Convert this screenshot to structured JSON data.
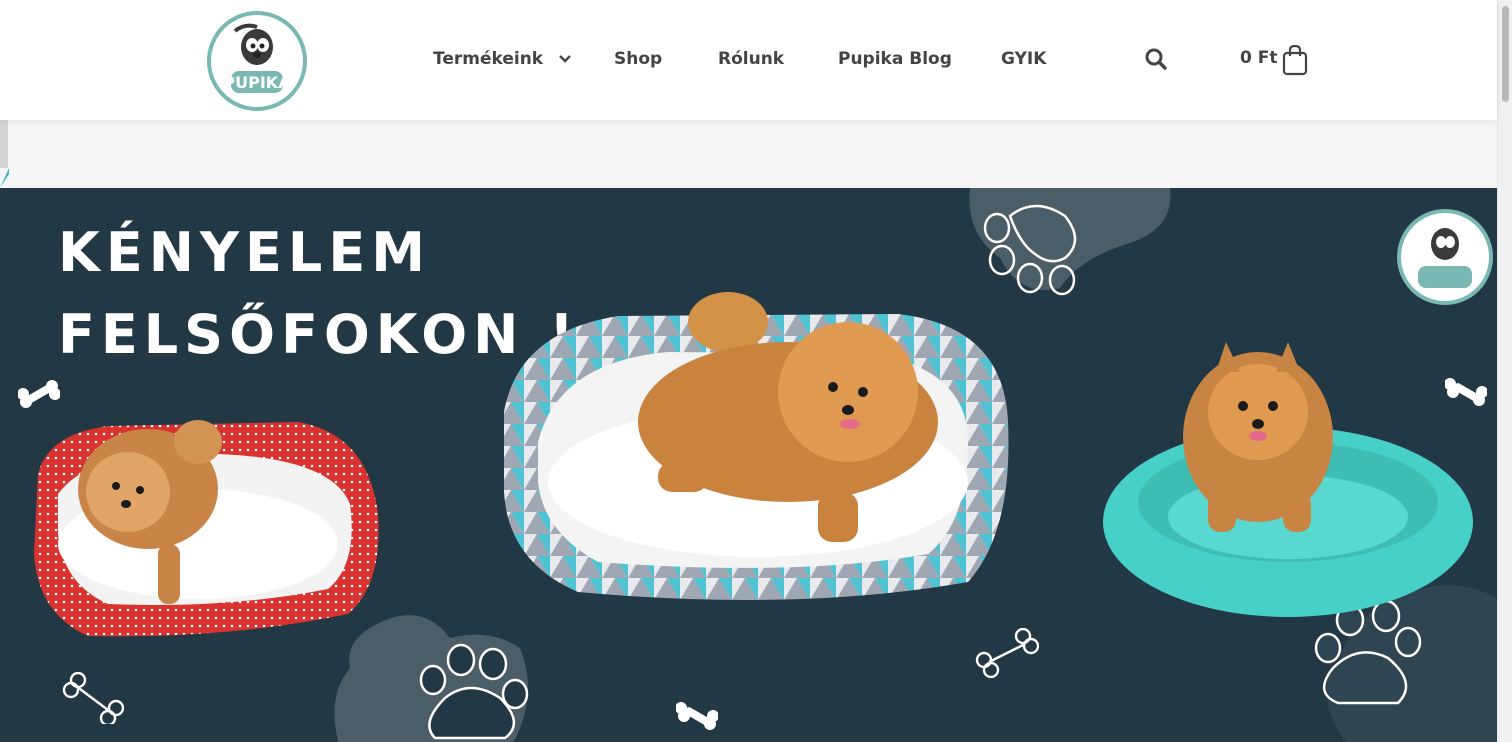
{
  "brand": {
    "name": "PUPIKA",
    "accent": "#7ab8b4",
    "dark": "#3a3a3a"
  },
  "nav": {
    "items": [
      {
        "label": "Termékeink",
        "has_dropdown": true
      },
      {
        "label": "Shop"
      },
      {
        "label": "Rólunk"
      },
      {
        "label": "Pupika Blog"
      },
      {
        "label": "GYIK"
      }
    ]
  },
  "header": {
    "search_icon": "search-icon",
    "cart_total": "0 Ft",
    "cart_icon": "shopping-bag-icon"
  },
  "banner": {
    "headline_line1": "KÉNYELEM",
    "headline_line2": "FELSŐFOKON !",
    "background": "#223844",
    "products": [
      {
        "name": "red-polka-dot-bed",
        "color": "#d9322f"
      },
      {
        "name": "triangle-pattern-bed",
        "color": "#4fc3d4"
      },
      {
        "name": "mint-plush-bed",
        "color": "#46d0c8"
      }
    ]
  }
}
